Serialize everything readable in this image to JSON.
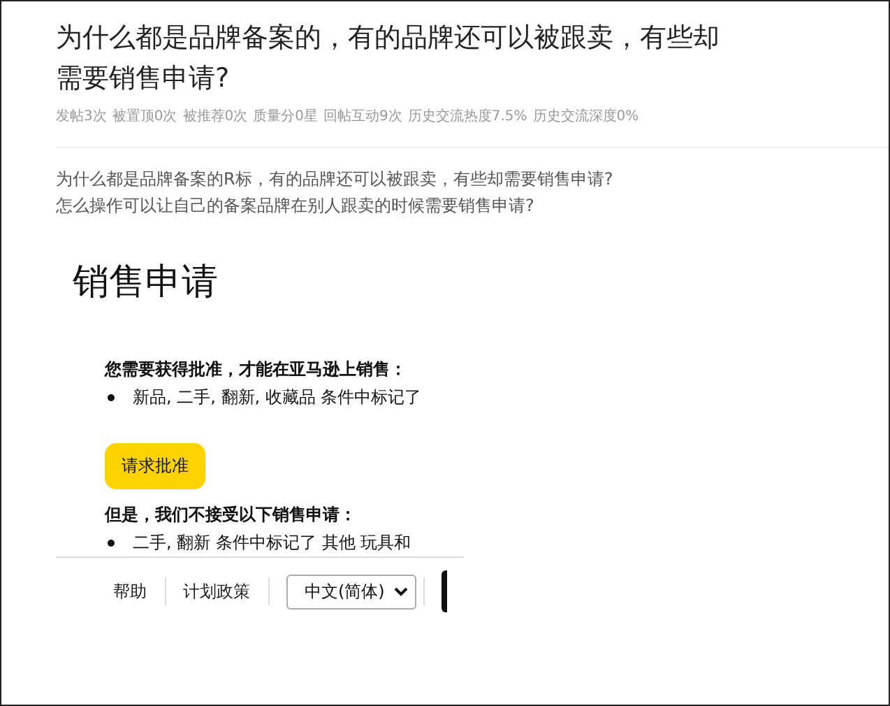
{
  "post": {
    "title": "为什么都是品牌备案的，有的品牌还可以被跟卖，有些却需要销售申请?",
    "stats": [
      "发帖3次",
      "被置顶0次",
      "被推荐0次",
      "质量分0星",
      "回帖互动9次",
      "历史交流热度7.5%",
      "历史交流深度0%"
    ],
    "body": [
      "为什么都是品牌备案的R标，有的品牌还可以被跟卖，有些却需要销售申请?",
      "怎么操作可以让自己的备案品牌在别人跟卖的时候需要销售申请?"
    ]
  },
  "embedded": {
    "heading": "销售申请",
    "sections": [
      {
        "kind": "heading",
        "text": "您需要获得批准，才能在亚马逊上销售："
      },
      {
        "kind": "bullet",
        "text": "新品, 二手, 翻新, 收藏品 条件中标记了"
      },
      {
        "kind": "button",
        "text": "请求批准"
      },
      {
        "kind": "heading",
        "text": "但是，我们不接受以下销售申请："
      },
      {
        "kind": "bullet",
        "text": "二手, 翻新 条件中标记了 其他 玩具和"
      }
    ],
    "footer": {
      "links": [
        "帮助",
        "计划政策"
      ],
      "language": {
        "value": "中文(简体)"
      }
    }
  }
}
